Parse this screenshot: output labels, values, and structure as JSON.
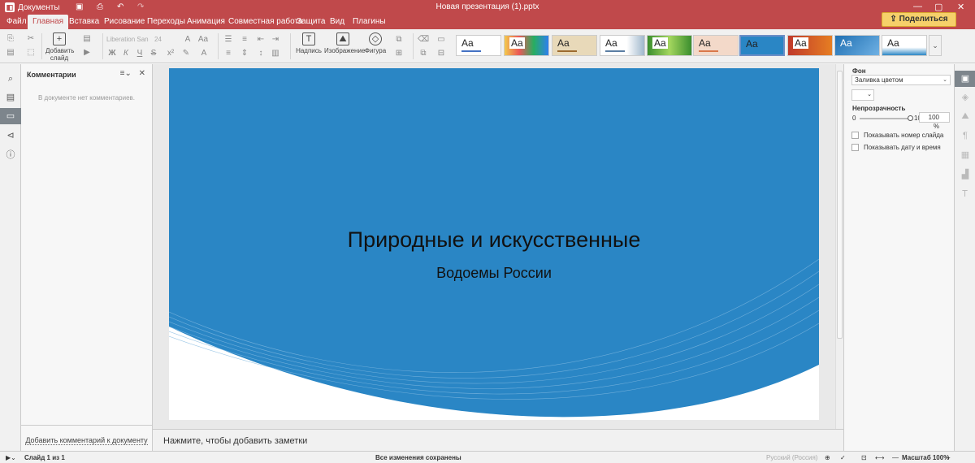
{
  "titlebar": {
    "app_name": "Документы",
    "doc_title": "Новая презентация (1).pptx",
    "share_label": "Поделиться"
  },
  "tabs": [
    "Файл",
    "Главная",
    "Вставка",
    "Рисование",
    "Переходы",
    "Анимация",
    "Совместная работа",
    "Защита",
    "Вид",
    "Плагины"
  ],
  "active_tab": "Главная",
  "toolbar": {
    "add_slide_label": "Добавить слайд",
    "font_name": "Liberation San",
    "font_size": "24",
    "text_box_label": "Надпись",
    "image_label": "Изображение",
    "shape_label": "Фигура",
    "theme_label": "Aa"
  },
  "comments_panel": {
    "title": "Комментарии",
    "empty_text": "В документе нет комментариев.",
    "add_link": "Добавить комментарий к документу"
  },
  "slide": {
    "title": "Природные и искусственные",
    "subtitle": "Водоемы России",
    "background_color": "#2a86c5"
  },
  "notes_placeholder": "Нажмите, чтобы добавить заметки",
  "right_panel": {
    "background_label": "Фон",
    "fill_type": "Заливка цветом",
    "opacity_label": "Непрозрачность",
    "slider_min": "0",
    "slider_max": "100",
    "opacity_value": "100 %",
    "opacity_level": 1.0,
    "show_slide_number": "Показывать номер слайда",
    "show_date_time": "Показывать дату и время"
  },
  "statusbar": {
    "slide_counter": "Слайд 1 из 1",
    "save_status": "Все изменения сохранены",
    "language": "Русский (Россия)",
    "zoom": "Масштаб 100%"
  },
  "colors": {
    "accent": "#c0494b",
    "share_button": "#f6d06a"
  }
}
